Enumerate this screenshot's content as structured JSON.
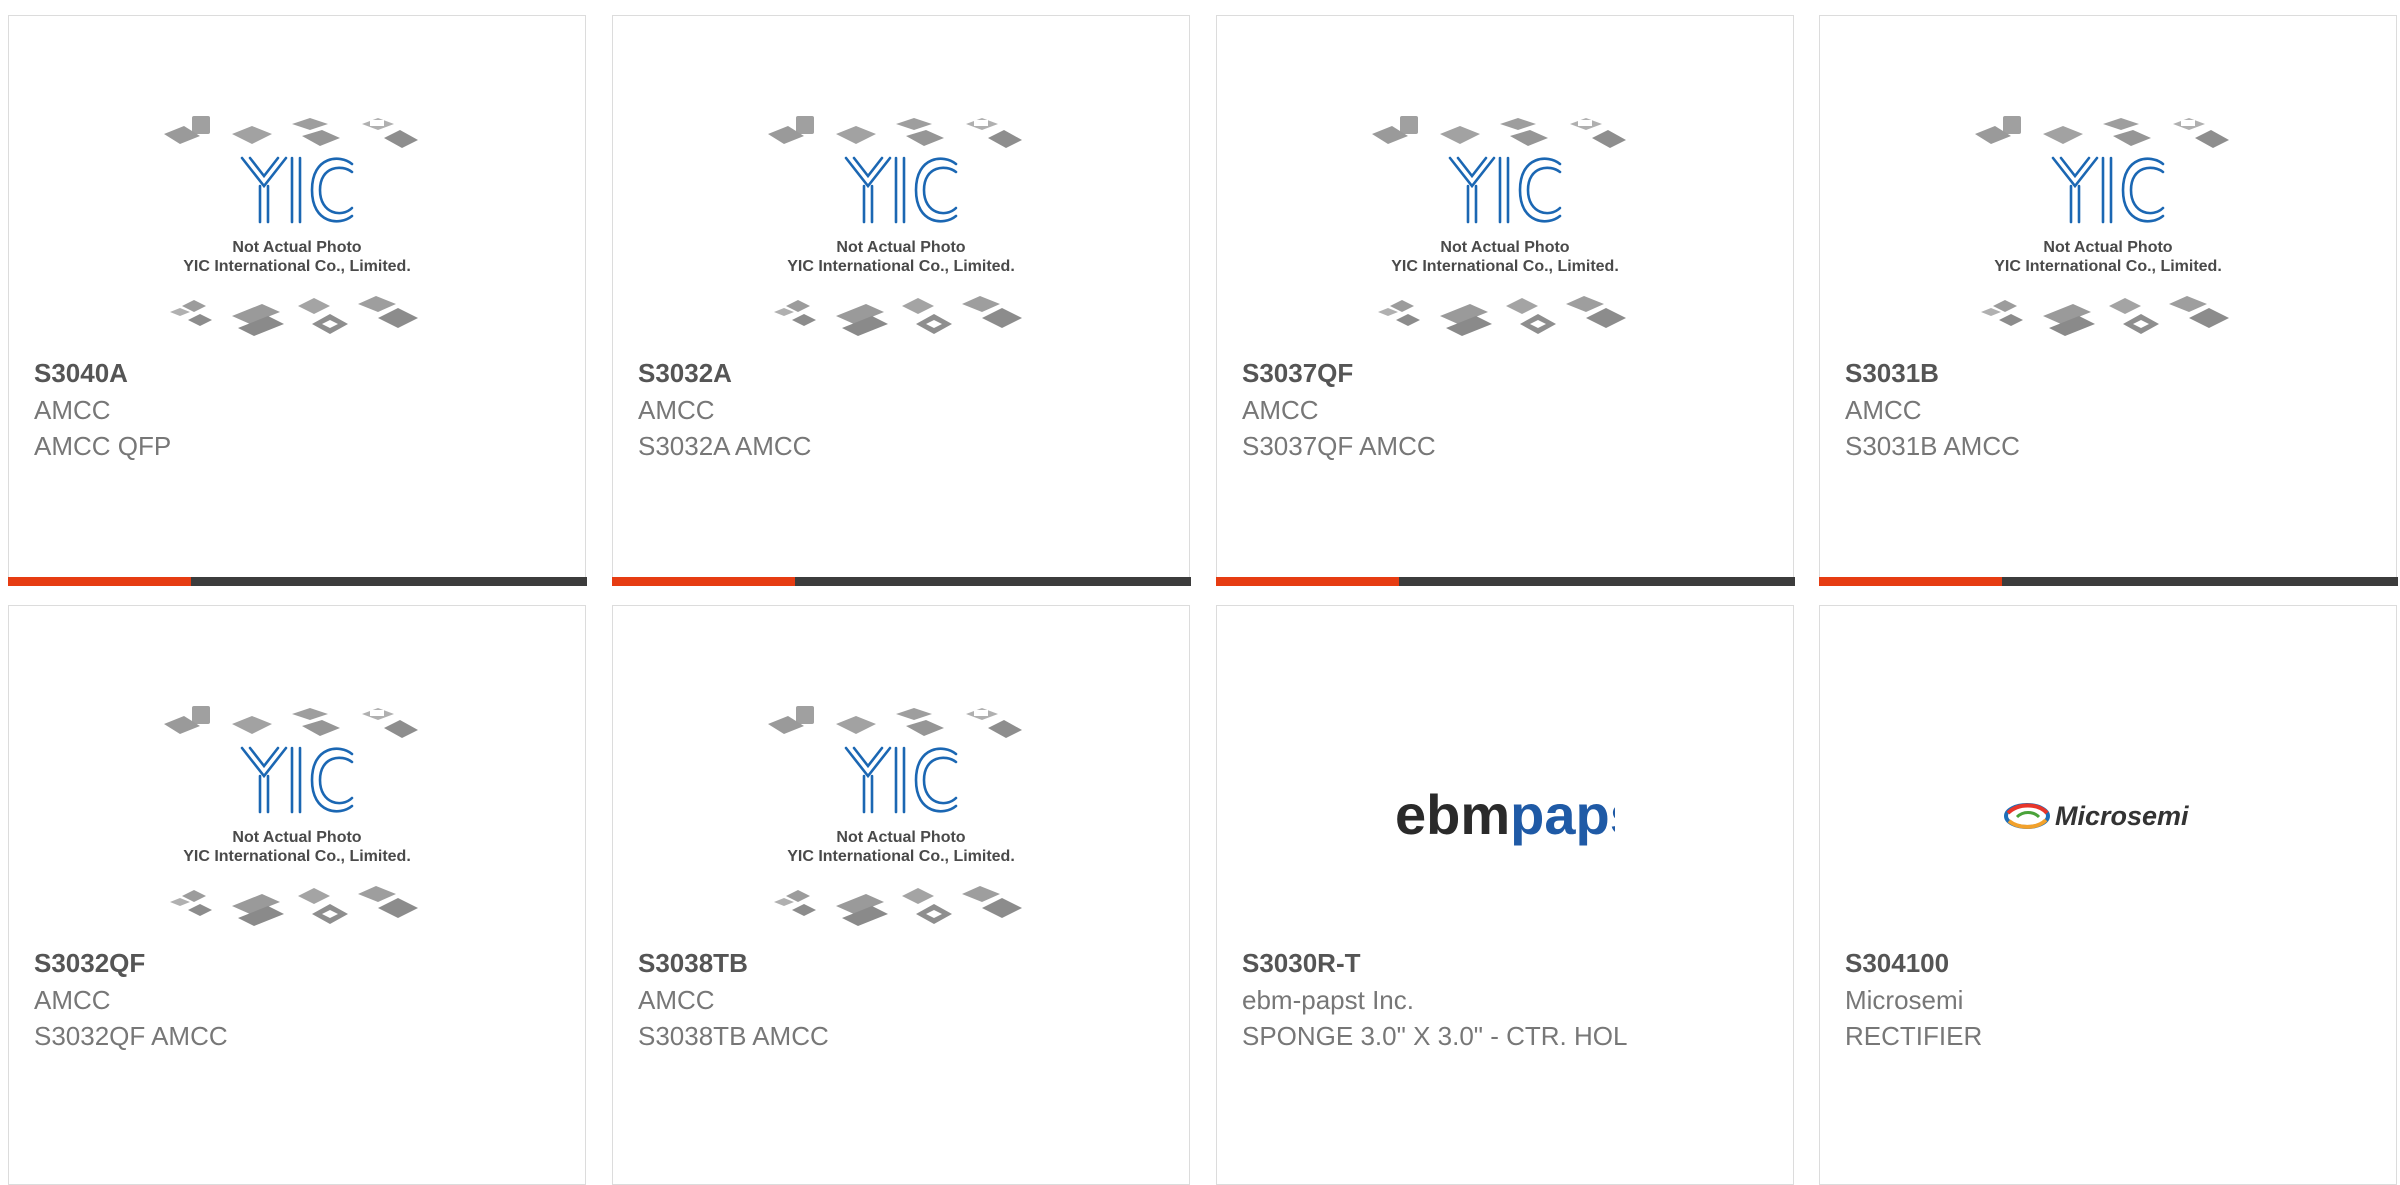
{
  "accent_color": "#e63c12",
  "placeholder": {
    "line1": "Not Actual Photo",
    "line2": "YIC International Co., Limited."
  },
  "products": [
    {
      "part_number": "S3040A",
      "manufacturer": "AMCC",
      "description": "AMCC QFP",
      "image": "yic-placeholder"
    },
    {
      "part_number": "S3032A",
      "manufacturer": "AMCC",
      "description": "S3032A AMCC",
      "image": "yic-placeholder"
    },
    {
      "part_number": "S3037QF",
      "manufacturer": "AMCC",
      "description": "S3037QF AMCC",
      "image": "yic-placeholder"
    },
    {
      "part_number": "S3031B",
      "manufacturer": "AMCC",
      "description": "S3031B AMCC",
      "image": "yic-placeholder"
    },
    {
      "part_number": "S3032QF",
      "manufacturer": "AMCC",
      "description": "S3032QF AMCC",
      "image": "yic-placeholder"
    },
    {
      "part_number": "S3038TB",
      "manufacturer": "AMCC",
      "description": "S3038TB AMCC",
      "image": "yic-placeholder"
    },
    {
      "part_number": "S3030R-T",
      "manufacturer": "ebm-papst Inc.",
      "description": "SPONGE 3.0\" X 3.0\" - CTR. HOL",
      "image": "ebmpapst-logo",
      "logo_text_1": "ebm",
      "logo_text_2": "papst"
    },
    {
      "part_number": "S304100",
      "manufacturer": "Microsemi",
      "description": "RECTIFIER",
      "image": "microsemi-logo",
      "logo_text": "Microsemi"
    }
  ]
}
